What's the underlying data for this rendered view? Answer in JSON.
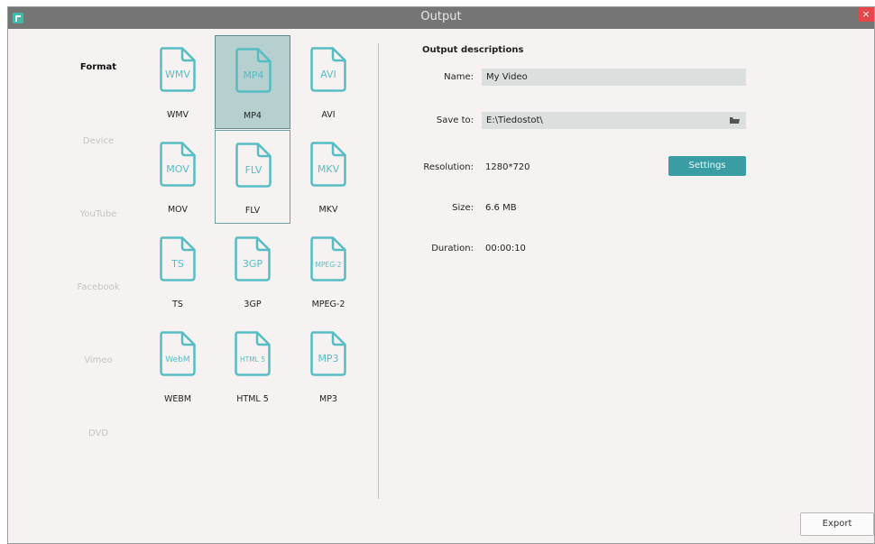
{
  "window": {
    "title": "Output",
    "close_label": "×"
  },
  "categories": [
    {
      "label": "Format",
      "active": true
    },
    {
      "label": "Device",
      "active": false
    },
    {
      "label": "YouTube",
      "active": false
    },
    {
      "label": "Facebook",
      "active": false
    },
    {
      "label": "Vimeo",
      "active": false
    },
    {
      "label": "DVD",
      "active": false
    }
  ],
  "formats": [
    {
      "icon_text": "WMV",
      "label": "WMV",
      "state": "normal"
    },
    {
      "icon_text": "MP4",
      "label": "MP4",
      "state": "selected"
    },
    {
      "icon_text": "AVI",
      "label": "AVI",
      "state": "normal"
    },
    {
      "icon_text": "MOV",
      "label": "MOV",
      "state": "normal"
    },
    {
      "icon_text": "FLV",
      "label": "FLV",
      "state": "hover"
    },
    {
      "icon_text": "MKV",
      "label": "MKV",
      "state": "normal"
    },
    {
      "icon_text": "TS",
      "label": "TS",
      "state": "normal"
    },
    {
      "icon_text": "3GP",
      "label": "3GP",
      "state": "normal"
    },
    {
      "icon_text": "MPEG-2",
      "label": "MPEG-2",
      "state": "normal"
    },
    {
      "icon_text": "WebM",
      "label": "WEBM",
      "state": "normal"
    },
    {
      "icon_text": "HTML 5",
      "label": "HTML 5",
      "state": "normal"
    },
    {
      "icon_text": "MP3",
      "label": "MP3",
      "state": "normal"
    }
  ],
  "output": {
    "heading": "Output descriptions",
    "name_label": "Name:",
    "name_value": "My Video",
    "save_label": "Save to:",
    "save_value": "E:\\Tiedostot\\",
    "resolution_label": "Resolution:",
    "resolution_value": "1280*720",
    "settings_label": "Settings",
    "size_label": "Size:",
    "size_value": "6.6 MB",
    "duration_label": "Duration:",
    "duration_value": "00:00:10"
  },
  "export_label": "Export",
  "colors": {
    "accent": "#3a9da3",
    "icon": "#56bdc4",
    "selected_bg": "#b6cfcf",
    "close": "#e5474a"
  }
}
